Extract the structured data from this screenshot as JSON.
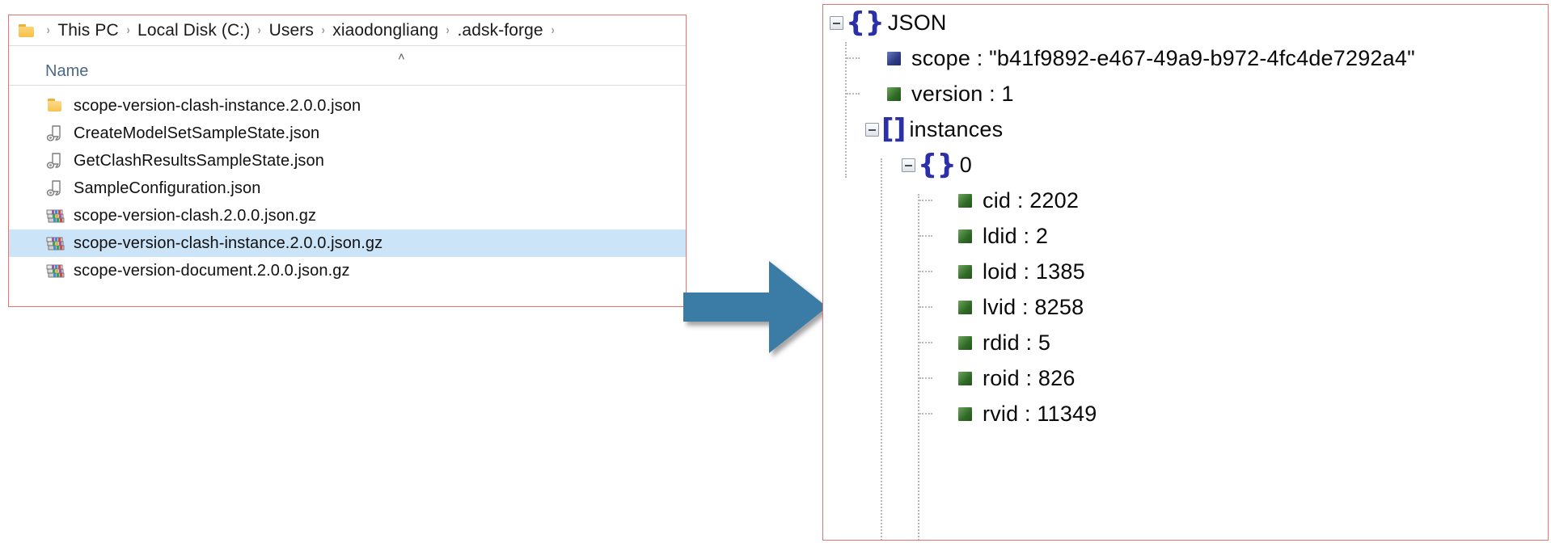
{
  "explorer": {
    "breadcrumb": {
      "folder_icon": "folder-icon",
      "separator": "›",
      "crumbs": [
        "This PC",
        "Local Disk (C:)",
        "Users",
        "xiaodongliang",
        ".adsk-forge"
      ]
    },
    "column_header": {
      "name": "Name",
      "sort_caret": "˄"
    },
    "files": [
      {
        "name": "scope-version-clash-instance.2.0.0.json",
        "icon": "folder-icon",
        "selected": false
      },
      {
        "name": "CreateModelSetSampleState.json",
        "icon": "json-file-icon",
        "selected": false
      },
      {
        "name": "GetClashResultsSampleState.json",
        "icon": "json-file-icon",
        "selected": false
      },
      {
        "name": "SampleConfiguration.json",
        "icon": "json-file-icon",
        "selected": false
      },
      {
        "name": "scope-version-clash.2.0.0.json.gz",
        "icon": "archive-file-icon",
        "selected": false
      },
      {
        "name": "scope-version-clash-instance.2.0.0.json.gz",
        "icon": "archive-file-icon",
        "selected": true
      },
      {
        "name": "scope-version-document.2.0.0.json.gz",
        "icon": "archive-file-icon",
        "selected": false
      }
    ]
  },
  "arrow": {
    "icon": "right-block-arrow-icon",
    "color": "#3b7ba7"
  },
  "json_tree": {
    "root": {
      "label": "JSON",
      "icon": "object-brace-icon",
      "expander": "collapse-box-icon"
    },
    "nodes": [
      {
        "label": "scope : \"b41f9892-e467-49a9-b972-4fc4de7292a4\"",
        "type": "string",
        "icon": "string-value-icon",
        "depth": 1
      },
      {
        "label": "version : 1",
        "type": "number",
        "icon": "number-value-icon",
        "depth": 1
      },
      {
        "label": "instances",
        "type": "array",
        "icon": "array-bracket-icon",
        "expander": "collapse-box-icon",
        "depth": 1
      },
      {
        "label": "0",
        "type": "object",
        "icon": "object-brace-icon",
        "expander": "collapse-box-icon",
        "depth": 2
      },
      {
        "label": "cid : 2202",
        "type": "number",
        "icon": "number-value-icon",
        "depth": 3
      },
      {
        "label": "ldid : 2",
        "type": "number",
        "icon": "number-value-icon",
        "depth": 3
      },
      {
        "label": "loid : 1385",
        "type": "number",
        "icon": "number-value-icon",
        "depth": 3
      },
      {
        "label": "lvid : 8258",
        "type": "number",
        "icon": "number-value-icon",
        "depth": 3
      },
      {
        "label": "rdid : 5",
        "type": "number",
        "icon": "number-value-icon",
        "depth": 3
      },
      {
        "label": "roid : 826",
        "type": "number",
        "icon": "number-value-icon",
        "depth": 3
      },
      {
        "label": "rvid : 11349",
        "type": "number",
        "icon": "number-value-icon",
        "depth": 3
      }
    ]
  },
  "colors": {
    "panel_border": "#e8736a",
    "selection": "#cce4f7",
    "arrow": "#3b7ba7",
    "brace": "#2b2fa8",
    "string_square": "#2c3a84",
    "number_square": "#2f6b25",
    "header_text": "#4c6a87"
  }
}
